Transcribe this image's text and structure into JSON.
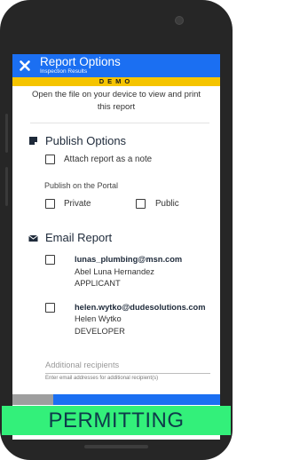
{
  "header": {
    "title": "Report Options",
    "subtitle": "Inspection Results"
  },
  "demo": {
    "label": "DEMO",
    "note": "Open the file on your device to view and print this report"
  },
  "publish": {
    "title": "Publish Options",
    "attach_label": "Attach report as a note",
    "attach_checked": false,
    "portal_label": "Publish on the Portal",
    "private_label": "Private",
    "private_checked": false,
    "public_label": "Public",
    "public_checked": false
  },
  "email": {
    "title": "Email Report",
    "recipients": [
      {
        "email": "lunas_plumbing@msn.com",
        "name": "Abel Luna Hernandez",
        "role": "APPLICANT",
        "checked": false
      },
      {
        "email": "helen.wytko@dudesolutions.com",
        "name": "Helen Wytko",
        "role": "DEVELOPER",
        "checked": false
      }
    ],
    "additional_placeholder": "Additional recipients",
    "additional_hint": "Enter email addresses for additional recipient(s)"
  },
  "banner": {
    "label": "PERMITTING"
  },
  "colors": {
    "header_blue": "#1b6ff2",
    "demo_yellow": "#f5c400",
    "banner_green": "#33f07a",
    "frame": "#262626"
  },
  "icons": {
    "close": "close-icon",
    "publish": "note-icon",
    "email": "envelope-icon"
  }
}
